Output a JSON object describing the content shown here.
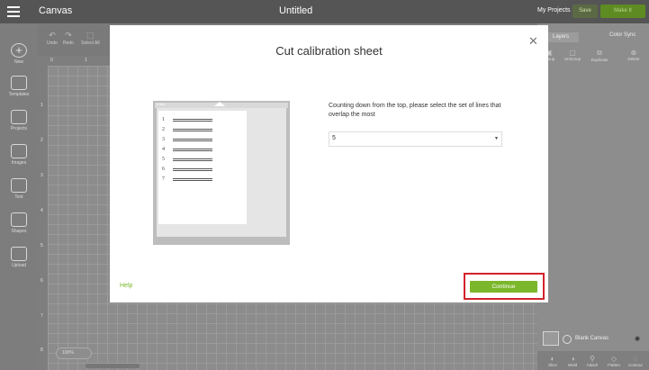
{
  "topbar": {
    "app_name": "Canvas",
    "doc_title": "Untitled",
    "my_projects": "My Projects",
    "save": "Save",
    "make_it": "Make It"
  },
  "sidebar": {
    "items": [
      {
        "label": "New",
        "icon": "plus-circle-icon"
      },
      {
        "label": "Templates",
        "icon": "shirt-icon"
      },
      {
        "label": "Projects",
        "icon": "projects-icon"
      },
      {
        "label": "Images",
        "icon": "image-icon"
      },
      {
        "label": "Text",
        "icon": "text-icon"
      },
      {
        "label": "Shapes",
        "icon": "shapes-icon"
      },
      {
        "label": "Upload",
        "icon": "upload-icon"
      }
    ]
  },
  "toolbar": {
    "undo": "Undo",
    "redo": "Redo",
    "select_all": "Select All"
  },
  "rulers": {
    "top": [
      "0",
      "1"
    ],
    "left": [
      "1",
      "2",
      "3",
      "4",
      "5",
      "6",
      "7",
      "8"
    ]
  },
  "canvas": {
    "zoom_label": "100%"
  },
  "layers_panel": {
    "tabs": [
      "Layers",
      "Color Sync"
    ],
    "actions": [
      "Group",
      "UnGroup",
      "Duplicate",
      "Delete"
    ],
    "blank_canvas": "Blank Canvas",
    "bottom_actions": [
      "Slice",
      "Weld",
      "Attach",
      "Flatten",
      "Contour"
    ]
  },
  "dialog": {
    "title": "Cut calibration sheet",
    "question": "Counting down from the top, please select the set of lines that overlap the most",
    "selected_value": "5",
    "help": "Help",
    "continue": "Continue",
    "mat_brand": "Cricut",
    "sheet_numbers": [
      "1",
      "2",
      "3",
      "4",
      "5",
      "6",
      "7"
    ]
  },
  "colors": {
    "accent": "#7bb72a",
    "highlight": "#d3212c"
  }
}
